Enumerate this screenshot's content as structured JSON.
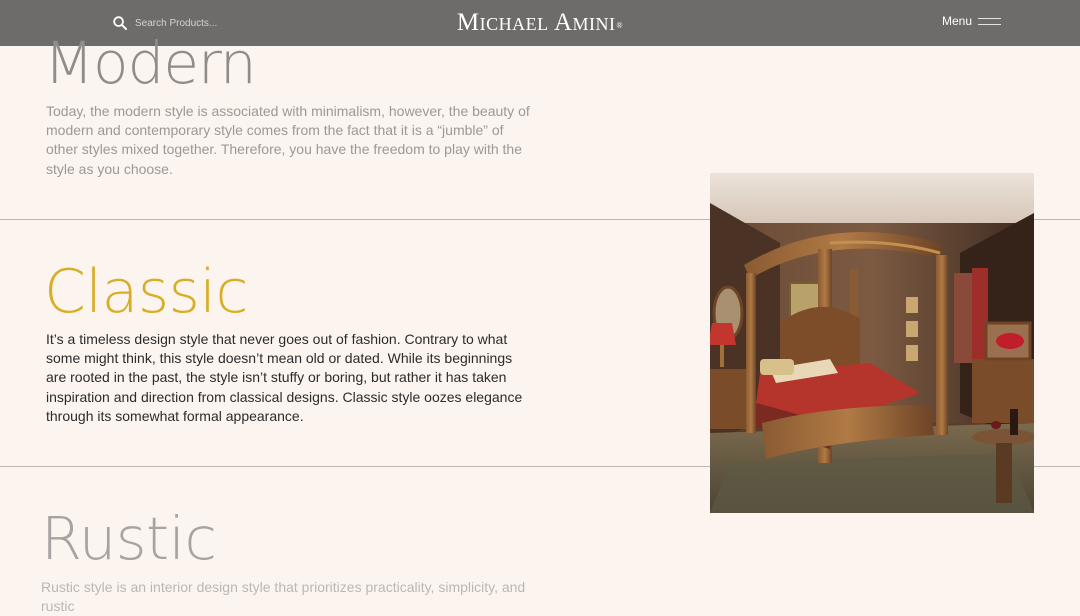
{
  "header": {
    "search_placeholder": "Search Products...",
    "logo_text": "Michael Amini",
    "logo_mark": "®",
    "menu_label": "Menu"
  },
  "styles": [
    {
      "title": "Modern",
      "description": "Today, the modern style is associated with minimalism, however, the beauty of modern and contemporary style comes from the fact that it is a “jumble” of other styles mixed together. Therefore, you have the freedom to play with the style as you choose."
    },
    {
      "title": "Classic",
      "description": "It’s a timeless design style that never goes out of fashion. Contrary to what some might think, this style doesn’t mean old or dated. While its beginnings are rooted in the past, the style isn’t stuffy or boring, but rather it has taken inspiration and direction from classical designs. Classic style oozes elegance through its somewhat formal appearance."
    },
    {
      "title": "Rustic",
      "description": "Rustic style is an interior design style that prioritizes practicality, simplicity, and rustic"
    }
  ],
  "colors": {
    "header_bg": "#6e6c6a",
    "page_bg": "#fcf5ef",
    "accent_gold": "#d7ae28"
  },
  "icons": {
    "search": "search-icon",
    "menu": "hamburger-menu-icon"
  }
}
